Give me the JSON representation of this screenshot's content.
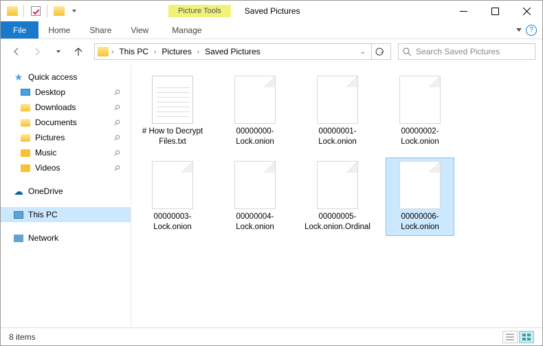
{
  "window": {
    "context_tab": "Picture Tools",
    "title": "Saved Pictures"
  },
  "ribbon": {
    "file": "File",
    "tabs": [
      "Home",
      "Share",
      "View"
    ],
    "manage": "Manage"
  },
  "breadcrumb": {
    "items": [
      "This PC",
      "Pictures",
      "Saved Pictures"
    ]
  },
  "search": {
    "placeholder": "Search Saved Pictures"
  },
  "sidebar": {
    "quick_access": "Quick access",
    "pinned": [
      {
        "label": "Desktop",
        "icon": "desktop"
      },
      {
        "label": "Downloads",
        "icon": "folder"
      },
      {
        "label": "Documents",
        "icon": "folder"
      },
      {
        "label": "Pictures",
        "icon": "folder"
      },
      {
        "label": "Music",
        "icon": "music"
      },
      {
        "label": "Videos",
        "icon": "video"
      }
    ],
    "onedrive": "OneDrive",
    "this_pc": "This PC",
    "network": "Network"
  },
  "files": [
    {
      "name": "# How to Decrypt Files.txt",
      "type": "txt",
      "selected": false
    },
    {
      "name": "00000000-Lock.onion",
      "type": "blank",
      "selected": false
    },
    {
      "name": "00000001-Lock.onion",
      "type": "blank",
      "selected": false
    },
    {
      "name": "00000002-Lock.onion",
      "type": "blank",
      "selected": false
    },
    {
      "name": "00000003-Lock.onion",
      "type": "blank",
      "selected": false
    },
    {
      "name": "00000004-Lock.onion",
      "type": "blank",
      "selected": false
    },
    {
      "name": "00000005-Lock.onion.Ordinal",
      "type": "blank",
      "selected": false
    },
    {
      "name": "00000006-Lock.onion",
      "type": "blank",
      "selected": true
    }
  ],
  "status": {
    "count": "8 items"
  }
}
